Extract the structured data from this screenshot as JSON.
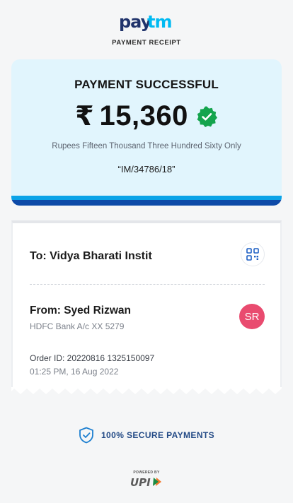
{
  "header": {
    "brand": "Paytm",
    "subtitle": "PAYMENT RECEIPT"
  },
  "payment": {
    "status": "PAYMENT SUCCESSFUL",
    "currency_symbol": "₹",
    "amount": "15,360",
    "amount_in_words": "Rupees Fifteen Thousand Three Hundred Sixty Only",
    "reference": "“IM/34786/18”"
  },
  "recipient": {
    "to_label": "To: Vidya Bharati Instit"
  },
  "sender": {
    "from_label": "From: Syed Rizwan",
    "bank": "HDFC Bank A/c XX 5279",
    "initials": "SR"
  },
  "order": {
    "id_label": "Order ID: 20220816 1325150097",
    "timestamp": "01:25 PM, 16 Aug 2022"
  },
  "footer": {
    "secure_text": "100% SECURE PAYMENTS",
    "powered_by": "POWERED BY",
    "upi_label": "UPI"
  },
  "colors": {
    "brand_dark": "#20336b",
    "brand_light": "#00baf2",
    "success_green": "#14a44d",
    "avatar": "#e94b6f",
    "card_bg": "#e1f5fd"
  },
  "icons": [
    "paytm-logo",
    "verified-check-icon",
    "qr-code-icon",
    "shield-check-icon",
    "upi-logo"
  ]
}
